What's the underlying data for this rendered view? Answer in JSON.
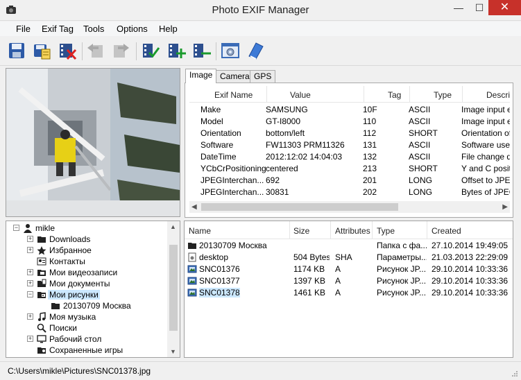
{
  "window": {
    "title": "Photo EXIF Manager",
    "minimize": "—",
    "maximize": "☐",
    "close": "✕"
  },
  "menu": {
    "items": [
      "File",
      "Exif Tag",
      "Tools",
      "Options",
      "Help"
    ]
  },
  "toolbar": {
    "buttons": [
      {
        "name": "save",
        "icon": "floppy-disk-icon",
        "enabled": true
      },
      {
        "name": "save-as",
        "icon": "save-as-icon",
        "enabled": true
      },
      {
        "name": "delete-exif",
        "icon": "film-delete-icon",
        "enabled": true
      },
      {
        "name": "back",
        "icon": "back-arrow-icon",
        "enabled": false
      },
      {
        "name": "forward",
        "icon": "forward-arrow-icon",
        "enabled": false
      },
      {
        "name": "check-tags",
        "icon": "film-check-icon",
        "enabled": true
      },
      {
        "name": "add-tag",
        "icon": "film-add-icon",
        "enabled": true
      },
      {
        "name": "remove-tag",
        "icon": "film-remove-icon",
        "enabled": true
      },
      {
        "name": "settings",
        "icon": "window-gear-icon",
        "enabled": true
      },
      {
        "name": "help",
        "icon": "help-book-icon",
        "enabled": true
      }
    ]
  },
  "tabs": [
    "Image",
    "Camera",
    "GPS"
  ],
  "active_tab": "Image",
  "exif": {
    "columns": [
      "Exif Name",
      "Value",
      "Tag",
      "Type",
      "Description"
    ],
    "column_display": [
      "Exif Name",
      "Value",
      "Tag",
      "Type",
      "Descrip"
    ],
    "rows": [
      {
        "name": "Make",
        "value": "SAMSUNG",
        "tag": "10F",
        "type": "ASCII",
        "desc": "Image input e"
      },
      {
        "name": "Model",
        "value": "GT-I8000",
        "tag": "110",
        "type": "ASCII",
        "desc": "Image input e"
      },
      {
        "name": "Orientation",
        "value": "bottom/left",
        "tag": "112",
        "type": "SHORT",
        "desc": "Orientation of"
      },
      {
        "name": "Software",
        "value": "FW11303 PRM11326",
        "tag": "131",
        "type": "ASCII",
        "desc": "Software use"
      },
      {
        "name": "DateTime",
        "value": "2012:12:02 14:04:03",
        "tag": "132",
        "type": "ASCII",
        "desc": "File change d"
      },
      {
        "name": "YCbCrPositioning",
        "value": "centered",
        "tag": "213",
        "type": "SHORT",
        "desc": "Y and C posit"
      },
      {
        "name": "JPEGInterchan...",
        "value": "692",
        "tag": "201",
        "type": "LONG",
        "desc": "Offset to JPE"
      },
      {
        "name": "JPEGInterchan...",
        "value": "30831",
        "tag": "202",
        "type": "LONG",
        "desc": "Bytes of JPEG"
      }
    ]
  },
  "tree": {
    "items": [
      {
        "label": "mikle",
        "icon": "user-icon",
        "level": 0,
        "expander": "−"
      },
      {
        "label": "Downloads",
        "icon": "folder-icon",
        "level": 1,
        "expander": "+"
      },
      {
        "label": "Избранное",
        "icon": "star-icon",
        "level": 1,
        "expander": "+"
      },
      {
        "label": "Контакты",
        "icon": "contacts-icon",
        "level": 1,
        "expander": ""
      },
      {
        "label": "Мои видеозаписи",
        "icon": "video-folder-icon",
        "level": 1,
        "expander": "+"
      },
      {
        "label": "Мои документы",
        "icon": "documents-folder-icon",
        "level": 1,
        "expander": "+"
      },
      {
        "label": "Мои рисунки",
        "icon": "pictures-folder-icon",
        "level": 1,
        "expander": "−",
        "selected": true
      },
      {
        "label": "20130709 Москва",
        "icon": "folder-icon",
        "level": 2,
        "expander": ""
      },
      {
        "label": "Моя музыка",
        "icon": "music-icon",
        "level": 1,
        "expander": "+"
      },
      {
        "label": "Поиски",
        "icon": "search-icon",
        "level": 1,
        "expander": ""
      },
      {
        "label": "Рабочий стол",
        "icon": "desktop-icon",
        "level": 1,
        "expander": "+"
      },
      {
        "label": "Сохраненные игры",
        "icon": "games-folder-icon",
        "level": 1,
        "expander": ""
      }
    ]
  },
  "files": {
    "columns": [
      "Name",
      "Size",
      "Attributes",
      "Type",
      "Created"
    ],
    "rows": [
      {
        "name": "20130709 Москва",
        "icon": "folder-icon",
        "size": "",
        "attr": "",
        "type": "Папка с фа...",
        "created": "27.10.2014 19:49:05"
      },
      {
        "name": "desktop",
        "icon": "settings-file-icon",
        "size": "504 Bytes",
        "attr": "SHA",
        "type": "Параметры...",
        "created": "21.03.2013 22:29:09"
      },
      {
        "name": "SNC01376",
        "icon": "image-file-icon",
        "size": "1174 KB",
        "attr": "A",
        "type": "Рисунок JP...",
        "created": "29.10.2014 10:33:36"
      },
      {
        "name": "SNC01377",
        "icon": "image-file-icon",
        "size": "1397 KB",
        "attr": "A",
        "type": "Рисунок JP...",
        "created": "29.10.2014 10:33:36"
      },
      {
        "name": "SNC01378",
        "icon": "image-file-icon",
        "size": "1461 KB",
        "attr": "A",
        "type": "Рисунок JP...",
        "created": "29.10.2014 10:33:36",
        "selected": true
      }
    ]
  },
  "status": {
    "path": "C:\\Users\\mikle\\Pictures\\SNC01378.jpg"
  }
}
